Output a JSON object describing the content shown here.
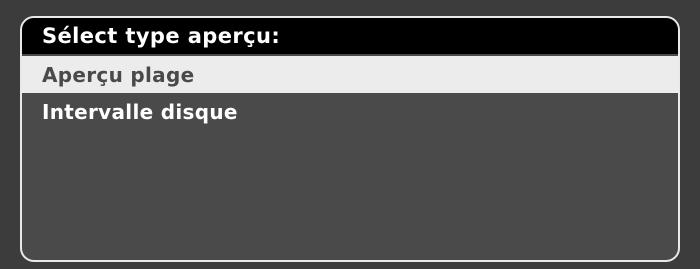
{
  "dialog": {
    "title": "Sélect type aperçu:",
    "items": [
      {
        "label": "Aperçu plage",
        "selected": true
      },
      {
        "label": "Intervalle disque",
        "selected": false
      }
    ]
  },
  "colors": {
    "background": "#3c3c3c",
    "dialog_background": "#4a4a4a",
    "header_background": "#000000",
    "selected_background": "#ececec",
    "text": "#ffffff",
    "selected_text": "#4a4a4a"
  }
}
